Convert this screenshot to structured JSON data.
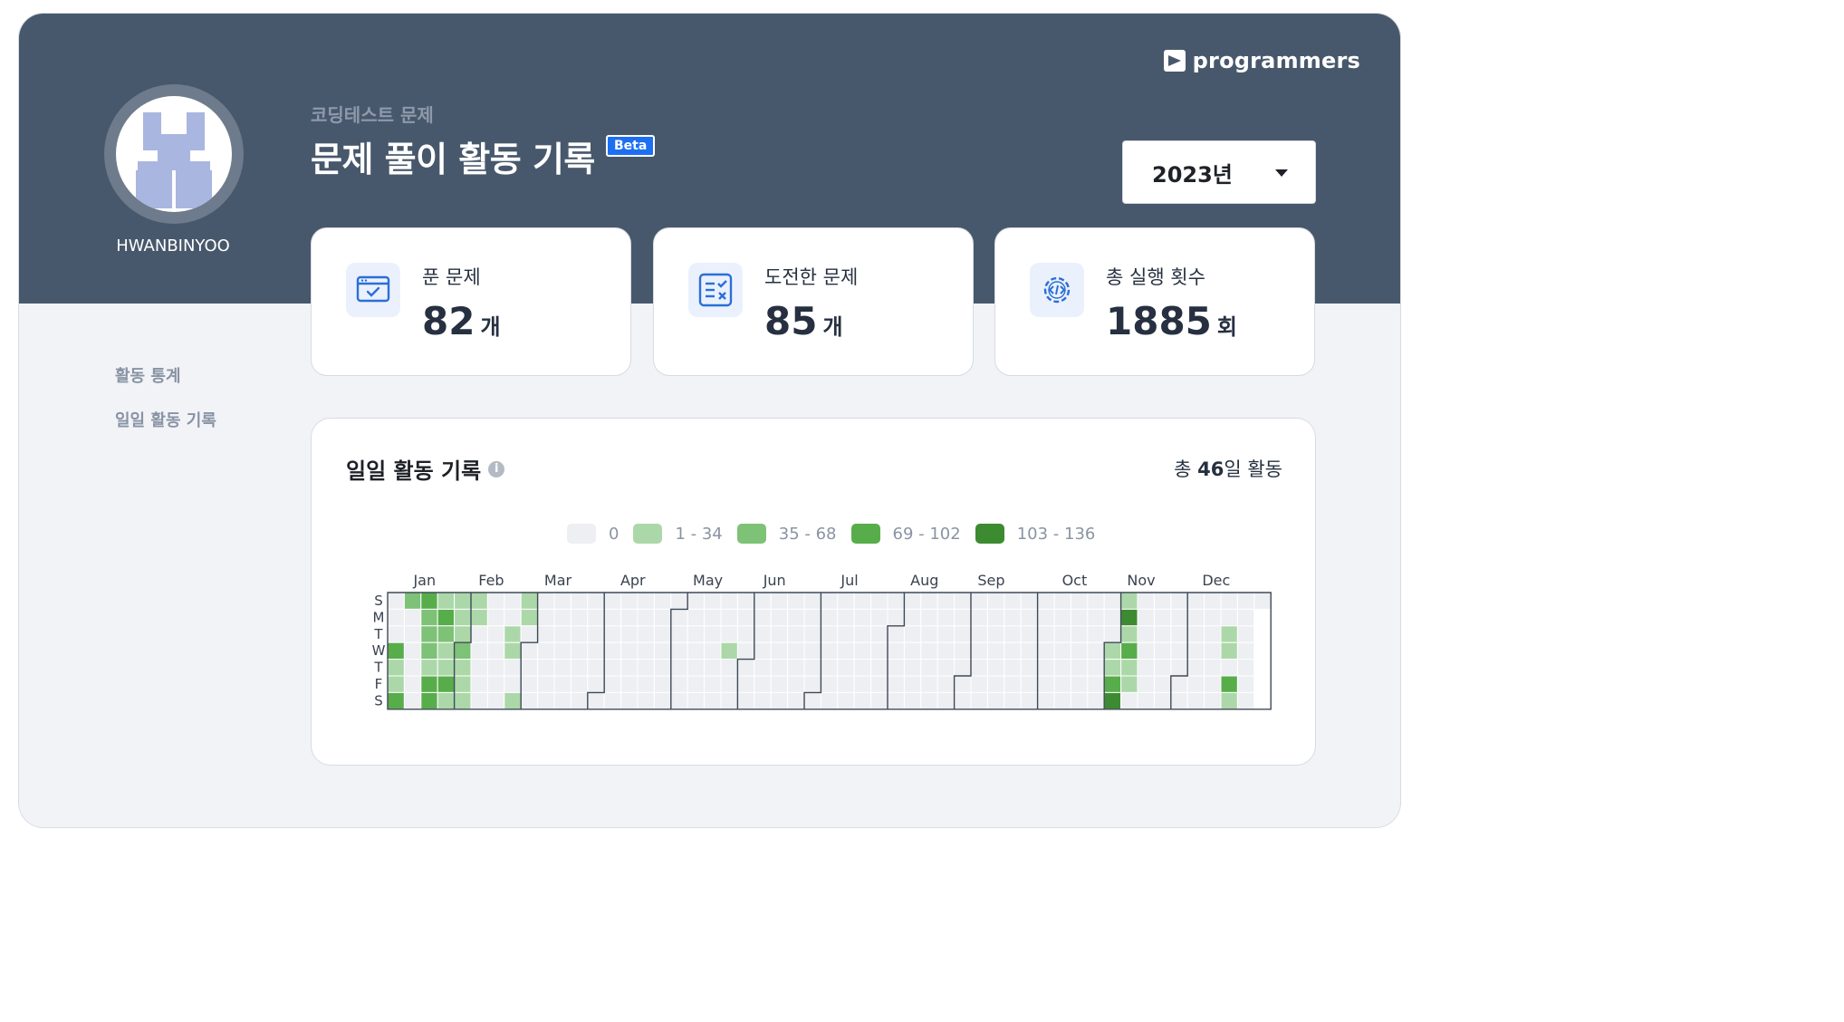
{
  "brand": {
    "name": "programmers"
  },
  "profile": {
    "username": "HWANBINYOO"
  },
  "header": {
    "subtitle": "코딩테스트 문제",
    "title": "문제 풀이 활동 기록",
    "badge": "Beta"
  },
  "year_select": {
    "value": "2023년"
  },
  "stats": [
    {
      "label": "푼 문제",
      "value": "82",
      "unit": "개",
      "icon": "browser-check-icon"
    },
    {
      "label": "도전한 문제",
      "value": "85",
      "unit": "개",
      "icon": "checklist-icon"
    },
    {
      "label": "총 실행 횟수",
      "value": "1885",
      "unit": "회",
      "icon": "code-gear-icon"
    }
  ],
  "sidebar": {
    "items": [
      {
        "label": "활동 통계"
      },
      {
        "label": "일일 활동 기록"
      }
    ]
  },
  "activity": {
    "title": "일일 활동 기록",
    "total_prefix": "총 ",
    "total_value": "46",
    "total_suffix": "일 활동",
    "legend": [
      {
        "label": "0",
        "color": "#edeff2"
      },
      {
        "label": "1 - 34",
        "color": "#acd8a9"
      },
      {
        "label": "35 - 68",
        "color": "#7dc276"
      },
      {
        "label": "69 - 102",
        "color": "#58ad4b"
      },
      {
        "label": "103 - 136",
        "color": "#3d8b31"
      }
    ],
    "weekdays": [
      "S",
      "M",
      "T",
      "W",
      "T",
      "F",
      "S"
    ],
    "months": [
      {
        "label": "Jan",
        "week": 2
      },
      {
        "label": "Feb",
        "week": 6
      },
      {
        "label": "Mar",
        "week": 10
      },
      {
        "label": "Apr",
        "week": 14.5
      },
      {
        "label": "May",
        "week": 19
      },
      {
        "label": "Jun",
        "week": 23
      },
      {
        "label": "Jul",
        "week": 27.5
      },
      {
        "label": "Aug",
        "week": 32
      },
      {
        "label": "Sep",
        "week": 36
      },
      {
        "label": "Oct",
        "week": 41
      },
      {
        "label": "Nov",
        "week": 45
      },
      {
        "label": "Dec",
        "week": 49.5
      }
    ],
    "year_start_weekday": 0,
    "cells": [
      {
        "week": 0,
        "day": 3,
        "level": 3
      },
      {
        "week": 0,
        "day": 4,
        "level": 1
      },
      {
        "week": 0,
        "day": 5,
        "level": 1
      },
      {
        "week": 0,
        "day": 6,
        "level": 3
      },
      {
        "week": 1,
        "day": 0,
        "level": 2
      },
      {
        "week": 2,
        "day": 0,
        "level": 3
      },
      {
        "week": 2,
        "day": 1,
        "level": 2
      },
      {
        "week": 2,
        "day": 2,
        "level": 2
      },
      {
        "week": 2,
        "day": 3,
        "level": 2
      },
      {
        "week": 2,
        "day": 4,
        "level": 1
      },
      {
        "week": 2,
        "day": 5,
        "level": 3
      },
      {
        "week": 2,
        "day": 6,
        "level": 3
      },
      {
        "week": 3,
        "day": 0,
        "level": 1
      },
      {
        "week": 3,
        "day": 1,
        "level": 3
      },
      {
        "week": 3,
        "day": 2,
        "level": 2
      },
      {
        "week": 3,
        "day": 3,
        "level": 1
      },
      {
        "week": 3,
        "day": 4,
        "level": 1
      },
      {
        "week": 3,
        "day": 5,
        "level": 3
      },
      {
        "week": 3,
        "day": 6,
        "level": 1
      },
      {
        "week": 4,
        "day": 0,
        "level": 1
      },
      {
        "week": 4,
        "day": 1,
        "level": 1
      },
      {
        "week": 4,
        "day": 2,
        "level": 1
      },
      {
        "week": 4,
        "day": 3,
        "level": 2
      },
      {
        "week": 4,
        "day": 4,
        "level": 1
      },
      {
        "week": 4,
        "day": 5,
        "level": 1
      },
      {
        "week": 4,
        "day": 6,
        "level": 1
      },
      {
        "week": 5,
        "day": 0,
        "level": 1
      },
      {
        "week": 5,
        "day": 1,
        "level": 1
      },
      {
        "week": 7,
        "day": 2,
        "level": 1
      },
      {
        "week": 7,
        "day": 3,
        "level": 1
      },
      {
        "week": 7,
        "day": 6,
        "level": 1
      },
      {
        "week": 8,
        "day": 0,
        "level": 1
      },
      {
        "week": 8,
        "day": 1,
        "level": 1
      },
      {
        "week": 20,
        "day": 3,
        "level": 1
      },
      {
        "week": 43,
        "day": 3,
        "level": 1
      },
      {
        "week": 43,
        "day": 4,
        "level": 1
      },
      {
        "week": 43,
        "day": 5,
        "level": 3
      },
      {
        "week": 43,
        "day": 6,
        "level": 4
      },
      {
        "week": 44,
        "day": 0,
        "level": 1
      },
      {
        "week": 44,
        "day": 1,
        "level": 4
      },
      {
        "week": 44,
        "day": 2,
        "level": 1
      },
      {
        "week": 44,
        "day": 3,
        "level": 3
      },
      {
        "week": 44,
        "day": 4,
        "level": 1
      },
      {
        "week": 44,
        "day": 5,
        "level": 1
      },
      {
        "week": 50,
        "day": 2,
        "level": 1
      },
      {
        "week": 50,
        "day": 3,
        "level": 1
      },
      {
        "week": 50,
        "day": 5,
        "level": 3
      },
      {
        "week": 50,
        "day": 6,
        "level": 1
      }
    ]
  }
}
